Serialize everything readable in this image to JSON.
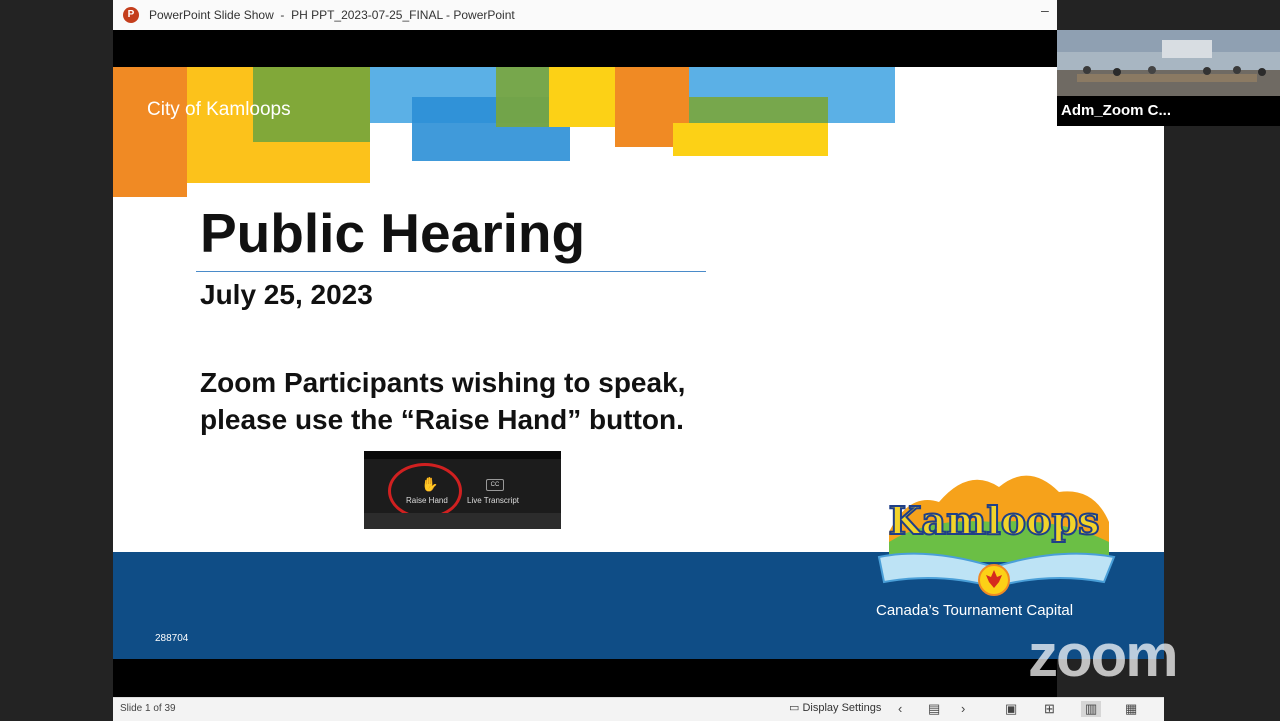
{
  "window": {
    "app_icon_letter": "P",
    "title": "PowerPoint Slide Show  -  PH PPT_2023-07-25_FINAL - PowerPoint"
  },
  "slide": {
    "organization": "City of Kamloops",
    "heading": "Public Hearing",
    "date": "July 25, 2023",
    "instruction_line1": "Zoom Participants wishing to speak,",
    "instruction_line2": "please use the “Raise Hand” button.",
    "zoom_raise_hand_label": "Raise Hand",
    "zoom_cc_label": "CC",
    "zoom_live_transcript_label": "Live Transcript",
    "slide_id": "288704",
    "logo_text": "Kamloops",
    "tagline": "Canada’s Tournament Capital",
    "colors": {
      "band": "#0f4d86",
      "orange": "#f08a24",
      "yellow": "#fcd116",
      "green": "#7aa63b",
      "sky": "#5bb0e6"
    }
  },
  "statusbar": {
    "slide_count": "Slide 1 of 39",
    "display_settings": "Display Settings"
  },
  "video": {
    "participant_name": "Adm_Zoom C..."
  },
  "watermark": "zoom"
}
